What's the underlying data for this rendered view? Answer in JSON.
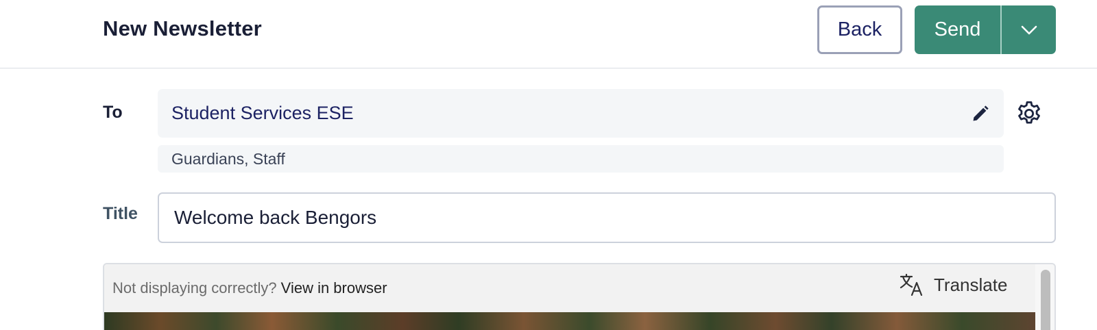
{
  "header": {
    "title": "New Newsletter",
    "back_label": "Back",
    "send_label": "Send"
  },
  "to": {
    "label": "To",
    "value": "Student Services ESE",
    "recipients": "Guardians, Staff"
  },
  "title_field": {
    "label": "Title",
    "value": "Welcome back Bengors"
  },
  "preview": {
    "not_displaying": "Not displaying correctly?",
    "view_link": "View in browser",
    "translate_label": "Translate"
  },
  "icons": {
    "dropdown": "chevron-down-icon",
    "edit": "pencil-icon",
    "settings": "gear-icon",
    "translate": "translate-icon"
  },
  "colors": {
    "accent": "#3a8a76",
    "field_bg": "#f4f6f8",
    "link_text": "#1c2263"
  }
}
